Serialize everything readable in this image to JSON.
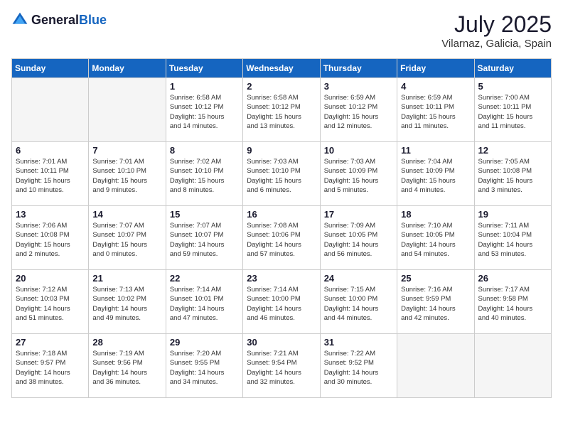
{
  "header": {
    "logo": {
      "general": "General",
      "blue": "Blue"
    },
    "title": "July 2025",
    "location": "Vilarnaz, Galicia, Spain"
  },
  "days_of_week": [
    "Sunday",
    "Monday",
    "Tuesday",
    "Wednesday",
    "Thursday",
    "Friday",
    "Saturday"
  ],
  "weeks": [
    [
      {
        "day": "",
        "info": ""
      },
      {
        "day": "",
        "info": ""
      },
      {
        "day": "1",
        "info": "Sunrise: 6:58 AM\nSunset: 10:12 PM\nDaylight: 15 hours\nand 14 minutes."
      },
      {
        "day": "2",
        "info": "Sunrise: 6:58 AM\nSunset: 10:12 PM\nDaylight: 15 hours\nand 13 minutes."
      },
      {
        "day": "3",
        "info": "Sunrise: 6:59 AM\nSunset: 10:12 PM\nDaylight: 15 hours\nand 12 minutes."
      },
      {
        "day": "4",
        "info": "Sunrise: 6:59 AM\nSunset: 10:11 PM\nDaylight: 15 hours\nand 11 minutes."
      },
      {
        "day": "5",
        "info": "Sunrise: 7:00 AM\nSunset: 10:11 PM\nDaylight: 15 hours\nand 11 minutes."
      }
    ],
    [
      {
        "day": "6",
        "info": "Sunrise: 7:01 AM\nSunset: 10:11 PM\nDaylight: 15 hours\nand 10 minutes."
      },
      {
        "day": "7",
        "info": "Sunrise: 7:01 AM\nSunset: 10:10 PM\nDaylight: 15 hours\nand 9 minutes."
      },
      {
        "day": "8",
        "info": "Sunrise: 7:02 AM\nSunset: 10:10 PM\nDaylight: 15 hours\nand 8 minutes."
      },
      {
        "day": "9",
        "info": "Sunrise: 7:03 AM\nSunset: 10:10 PM\nDaylight: 15 hours\nand 6 minutes."
      },
      {
        "day": "10",
        "info": "Sunrise: 7:03 AM\nSunset: 10:09 PM\nDaylight: 15 hours\nand 5 minutes."
      },
      {
        "day": "11",
        "info": "Sunrise: 7:04 AM\nSunset: 10:09 PM\nDaylight: 15 hours\nand 4 minutes."
      },
      {
        "day": "12",
        "info": "Sunrise: 7:05 AM\nSunset: 10:08 PM\nDaylight: 15 hours\nand 3 minutes."
      }
    ],
    [
      {
        "day": "13",
        "info": "Sunrise: 7:06 AM\nSunset: 10:08 PM\nDaylight: 15 hours\nand 2 minutes."
      },
      {
        "day": "14",
        "info": "Sunrise: 7:07 AM\nSunset: 10:07 PM\nDaylight: 15 hours\nand 0 minutes."
      },
      {
        "day": "15",
        "info": "Sunrise: 7:07 AM\nSunset: 10:07 PM\nDaylight: 14 hours\nand 59 minutes."
      },
      {
        "day": "16",
        "info": "Sunrise: 7:08 AM\nSunset: 10:06 PM\nDaylight: 14 hours\nand 57 minutes."
      },
      {
        "day": "17",
        "info": "Sunrise: 7:09 AM\nSunset: 10:05 PM\nDaylight: 14 hours\nand 56 minutes."
      },
      {
        "day": "18",
        "info": "Sunrise: 7:10 AM\nSunset: 10:05 PM\nDaylight: 14 hours\nand 54 minutes."
      },
      {
        "day": "19",
        "info": "Sunrise: 7:11 AM\nSunset: 10:04 PM\nDaylight: 14 hours\nand 53 minutes."
      }
    ],
    [
      {
        "day": "20",
        "info": "Sunrise: 7:12 AM\nSunset: 10:03 PM\nDaylight: 14 hours\nand 51 minutes."
      },
      {
        "day": "21",
        "info": "Sunrise: 7:13 AM\nSunset: 10:02 PM\nDaylight: 14 hours\nand 49 minutes."
      },
      {
        "day": "22",
        "info": "Sunrise: 7:14 AM\nSunset: 10:01 PM\nDaylight: 14 hours\nand 47 minutes."
      },
      {
        "day": "23",
        "info": "Sunrise: 7:14 AM\nSunset: 10:00 PM\nDaylight: 14 hours\nand 46 minutes."
      },
      {
        "day": "24",
        "info": "Sunrise: 7:15 AM\nSunset: 10:00 PM\nDaylight: 14 hours\nand 44 minutes."
      },
      {
        "day": "25",
        "info": "Sunrise: 7:16 AM\nSunset: 9:59 PM\nDaylight: 14 hours\nand 42 minutes."
      },
      {
        "day": "26",
        "info": "Sunrise: 7:17 AM\nSunset: 9:58 PM\nDaylight: 14 hours\nand 40 minutes."
      }
    ],
    [
      {
        "day": "27",
        "info": "Sunrise: 7:18 AM\nSunset: 9:57 PM\nDaylight: 14 hours\nand 38 minutes."
      },
      {
        "day": "28",
        "info": "Sunrise: 7:19 AM\nSunset: 9:56 PM\nDaylight: 14 hours\nand 36 minutes."
      },
      {
        "day": "29",
        "info": "Sunrise: 7:20 AM\nSunset: 9:55 PM\nDaylight: 14 hours\nand 34 minutes."
      },
      {
        "day": "30",
        "info": "Sunrise: 7:21 AM\nSunset: 9:54 PM\nDaylight: 14 hours\nand 32 minutes."
      },
      {
        "day": "31",
        "info": "Sunrise: 7:22 AM\nSunset: 9:52 PM\nDaylight: 14 hours\nand 30 minutes."
      },
      {
        "day": "",
        "info": ""
      },
      {
        "day": "",
        "info": ""
      }
    ]
  ]
}
